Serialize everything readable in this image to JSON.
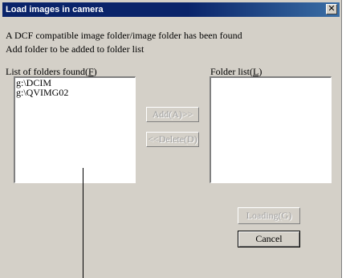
{
  "window": {
    "title": "Load images in camera",
    "close_glyph": "✕"
  },
  "messages": {
    "found": "A DCF compatible image folder/image folder has been found",
    "instruction": "Add folder to be added to folder list"
  },
  "found_list": {
    "label_prefix": "List of folders found(",
    "label_key": "F",
    "label_suffix": ")",
    "items": [
      "g:\\DCIM",
      "g:\\QVIMG02"
    ]
  },
  "folder_list": {
    "label_prefix": "Folder list(",
    "label_key": "L",
    "label_suffix": ")",
    "items": []
  },
  "buttons": {
    "add": "Add(A)>>",
    "delete": "<<Delete(D)",
    "loading": "Loading(G)",
    "cancel": "Cancel"
  }
}
